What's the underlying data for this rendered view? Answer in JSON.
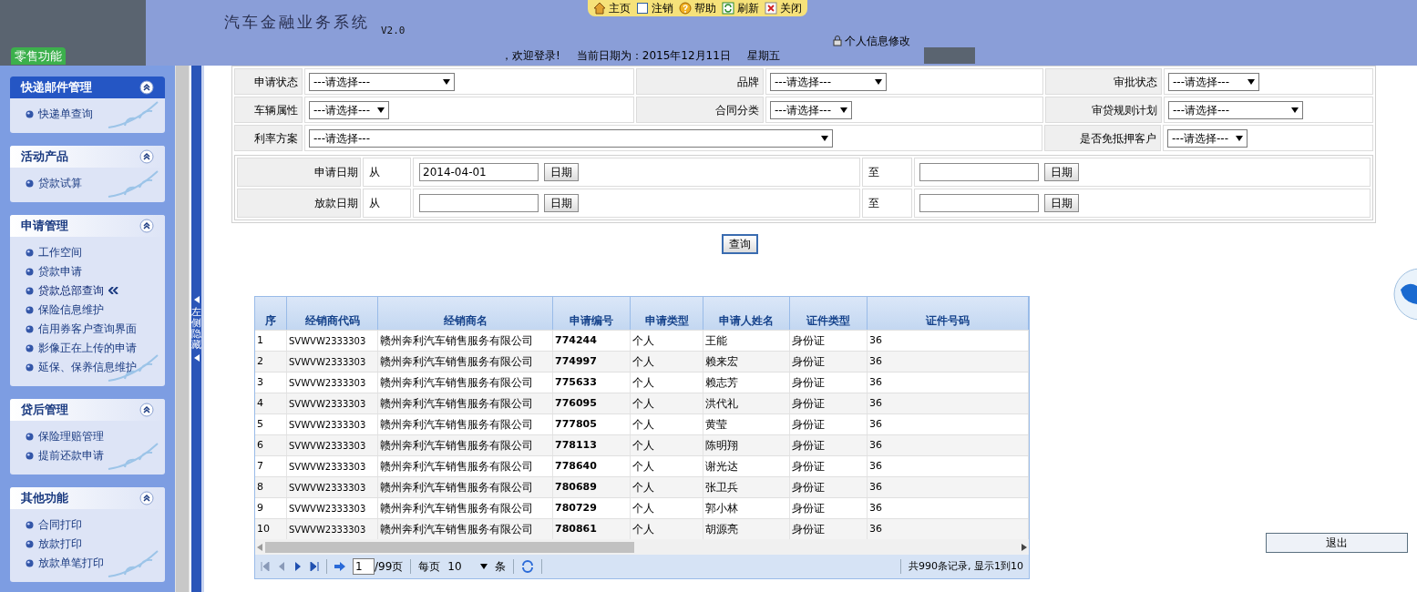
{
  "header": {
    "title": "汽车金融业务系统",
    "version": "V2.0",
    "badge": "零售功能",
    "welcome": "，欢迎登录!",
    "date": "当前日期为：2015年12月11日",
    "weekday": "星期五",
    "profile_link": "个人信息修改",
    "toolbar": [
      {
        "kind": "home",
        "label": "主页"
      },
      {
        "kind": "logout",
        "label": "注销"
      },
      {
        "kind": "help",
        "label": "帮助"
      },
      {
        "kind": "refresh",
        "label": "刷新"
      },
      {
        "kind": "close",
        "label": "关闭"
      }
    ]
  },
  "sidebar": {
    "groups": [
      {
        "title": "快递邮件管理",
        "active": true,
        "expanded": true,
        "items": [
          {
            "label": "快递单查询",
            "selected": false
          }
        ]
      },
      {
        "title": "活动产品",
        "active": false,
        "expanded": true,
        "items": [
          {
            "label": "贷款试算",
            "selected": false
          }
        ]
      },
      {
        "title": "申请管理",
        "active": false,
        "expanded": true,
        "items": [
          {
            "label": "工作空间",
            "selected": false
          },
          {
            "label": "贷款申请",
            "selected": false
          },
          {
            "label": "贷款总部查询",
            "selected": true
          },
          {
            "label": "保险信息维护",
            "selected": false
          },
          {
            "label": "信用券客户查询界面",
            "selected": false
          },
          {
            "label": "影像正在上传的申请",
            "selected": false
          },
          {
            "label": "延保、保养信息维护",
            "selected": false
          }
        ]
      },
      {
        "title": "贷后管理",
        "active": false,
        "expanded": true,
        "items": [
          {
            "label": "保险理赔管理",
            "selected": false
          },
          {
            "label": "提前还款申请",
            "selected": false
          }
        ]
      },
      {
        "title": "其他功能",
        "active": false,
        "expanded": true,
        "items": [
          {
            "label": "合同打印",
            "selected": false
          },
          {
            "label": "放款打印",
            "selected": false
          },
          {
            "label": "放款单笔打印",
            "selected": false
          }
        ]
      }
    ],
    "hide_label": "左侧隐藏"
  },
  "filters": [
    [
      {
        "label": "申请状态",
        "value": "---请选择---"
      },
      {
        "label": "品牌",
        "value": "---请选择---"
      },
      {
        "label": "审批状态",
        "value": "---请选择---"
      }
    ],
    [
      {
        "label": "车辆属性",
        "value": "---请选择---"
      },
      {
        "label": "合同分类",
        "value": "---请选择---"
      },
      {
        "label": "审贷规则计划",
        "value": "---请选择---"
      }
    ],
    [
      {
        "label": "利率方案",
        "value": "---请选择---"
      },
      {
        "label": "是否免抵押客户",
        "value": "---请选择---"
      }
    ]
  ],
  "date_filters": [
    {
      "label": "申请日期",
      "from": "从",
      "from_value": "2014-04-01",
      "from_button": "日期",
      "to": "至",
      "to_button": "日期"
    },
    {
      "label": "放款日期",
      "from": "从",
      "from_button": "日期",
      "to": "至",
      "to_button": "日期"
    }
  ],
  "search_button": "查询",
  "table": {
    "columns": [
      "序",
      "经销商代码",
      "经销商名",
      "申请编号",
      "申请类型",
      "申请人姓名",
      "证件类型",
      "证件号码"
    ],
    "rows": [
      [
        "1",
        "SVWVW2333303",
        "赣州奔利汽车销售服务有限公司",
        "774244",
        "个人",
        "王能",
        "身份证",
        "36"
      ],
      [
        "2",
        "SVWVW2333303",
        "赣州奔利汽车销售服务有限公司",
        "774997",
        "个人",
        "赖来宏",
        "身份证",
        "36"
      ],
      [
        "3",
        "SVWVW2333303",
        "赣州奔利汽车销售服务有限公司",
        "775633",
        "个人",
        "赖志芳",
        "身份证",
        "36"
      ],
      [
        "4",
        "SVWVW2333303",
        "赣州奔利汽车销售服务有限公司",
        "776095",
        "个人",
        "洪代礼",
        "身份证",
        "36"
      ],
      [
        "5",
        "SVWVW2333303",
        "赣州奔利汽车销售服务有限公司",
        "777805",
        "个人",
        "黄莹",
        "身份证",
        "36"
      ],
      [
        "6",
        "SVWVW2333303",
        "赣州奔利汽车销售服务有限公司",
        "778113",
        "个人",
        "陈明翔",
        "身份证",
        "36"
      ],
      [
        "7",
        "SVWVW2333303",
        "赣州奔利汽车销售服务有限公司",
        "778640",
        "个人",
        "谢光达",
        "身份证",
        "36"
      ],
      [
        "8",
        "SVWVW2333303",
        "赣州奔利汽车销售服务有限公司",
        "780689",
        "个人",
        "张卫兵",
        "身份证",
        "36"
      ],
      [
        "9",
        "SVWVW2333303",
        "赣州奔利汽车销售服务有限公司",
        "780729",
        "个人",
        "郭小林",
        "身份证",
        "36"
      ],
      [
        "10",
        "SVWVW2333303",
        "赣州奔利汽车销售服务有限公司",
        "780861",
        "个人",
        "胡源亮",
        "身份证",
        "36"
      ]
    ]
  },
  "pager": {
    "page": "1",
    "pages": "/99页",
    "per_page_label": "每页",
    "per_page": "10",
    "unit": "条",
    "summary": "共990条记录, 显示1到10"
  },
  "exit_button": "退出"
}
